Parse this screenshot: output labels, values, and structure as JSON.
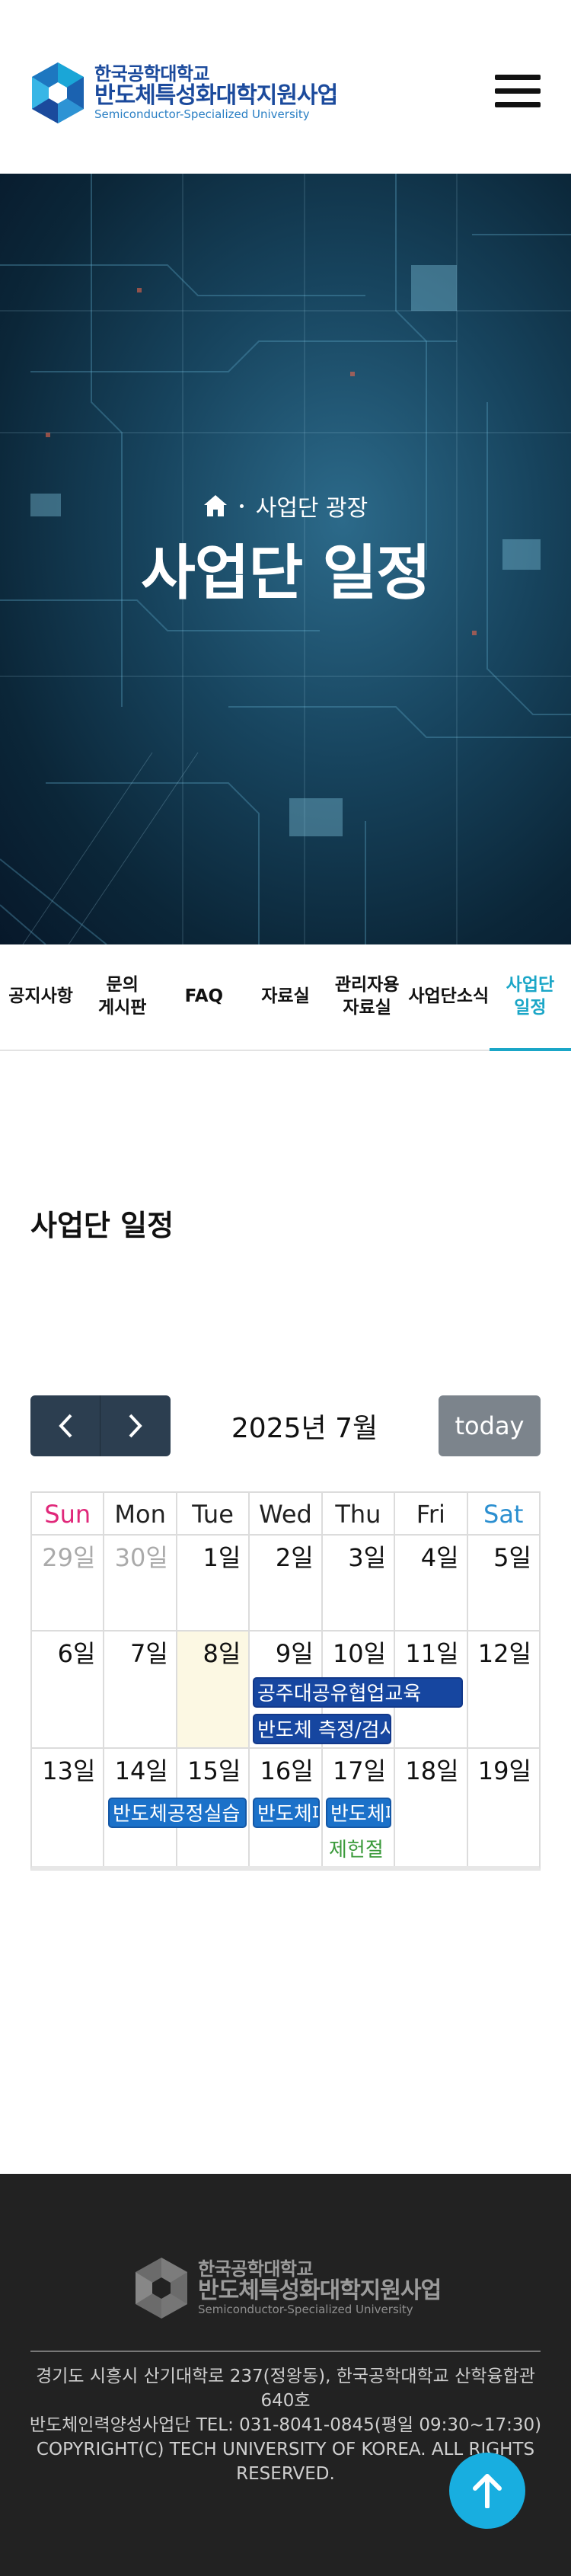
{
  "header": {
    "logo_line1": "한국공학대학교",
    "logo_line2": "반도체특성화대학지원사업",
    "logo_line3": "Semiconductor-Specialized University",
    "menu_icon": "hamburger-menu-icon"
  },
  "hero": {
    "breadcrumb_home_icon": "home-icon",
    "breadcrumb_section": "사업단 광장",
    "title": "사업단 일정"
  },
  "tabs": [
    {
      "label": "공지사항",
      "active": false
    },
    {
      "label": "문의\n게시판",
      "active": false
    },
    {
      "label": "FAQ",
      "active": false
    },
    {
      "label": "자료실",
      "active": false
    },
    {
      "label": "관리자용\n자료실",
      "active": false
    },
    {
      "label": "사업단소식",
      "active": false
    },
    {
      "label": "사업단\n일정",
      "active": true
    }
  ],
  "page_title": "사업단 일정",
  "calendar": {
    "title": "2025년 7월",
    "today_label": "today",
    "prev_icon": "chevron-left-icon",
    "next_icon": "chevron-right-icon",
    "weekdays": [
      "Sun",
      "Mon",
      "Tue",
      "Wed",
      "Thu",
      "Fri",
      "Sat"
    ],
    "weeks": [
      [
        "29일",
        "30일",
        "1일",
        "2일",
        "3일",
        "4일",
        "5일"
      ],
      [
        "6일",
        "7일",
        "8일",
        "9일",
        "10일",
        "11일",
        "12일"
      ],
      [
        "13일",
        "14일",
        "15일",
        "16일",
        "17일",
        "18일",
        "19일"
      ]
    ],
    "events": [
      {
        "title": "공주대공유협업교육"
      },
      {
        "title": "반도체 측정/검사"
      },
      {
        "title": "반도체공정실습"
      },
      {
        "title": "반도체패"
      },
      {
        "title": "반도체패"
      },
      {
        "title": "제헌절"
      }
    ]
  },
  "footer": {
    "logo_line1": "한국공학대학교",
    "logo_line2": "반도체특성화대학지원사업",
    "logo_line3": "Semiconductor-Specialized University",
    "address": "경기도 시흥시 산기대학로 237(정왕동), 한국공학대학교 산학융합관 640호",
    "contact": "반도체인력양성사업단 TEL: 031-8041-0845(평일 09:30~17:30)",
    "copyright": "COPYRIGHT(C) TECH UNIVERSITY OF KOREA. ALL RIGHTS RESERVED.",
    "top_icon": "arrow-up-icon"
  },
  "colors": {
    "brand_blue": "#1b4a9c",
    "accent_cyan": "#1aa6c7",
    "nav_dark": "#2c3e50",
    "today_gray": "#7c848c",
    "event_blue": "#1b71c9",
    "holiday_green": "#3a9a3a",
    "sunday_pink": "#e0287a",
    "saturday_blue": "#2b8fd0",
    "footer_bg": "#222222",
    "top_button": "#18aee0"
  }
}
